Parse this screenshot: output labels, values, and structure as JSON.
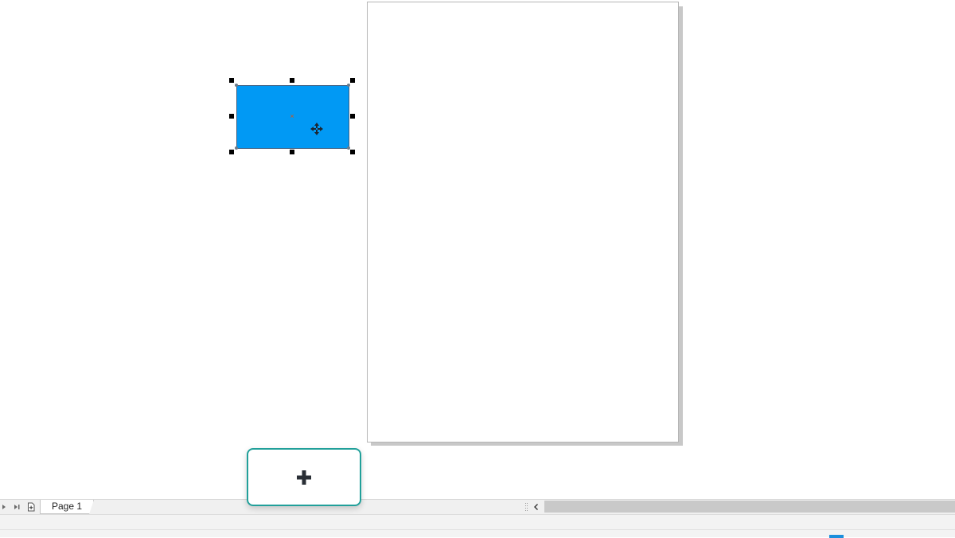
{
  "document": {
    "pages": [
      {
        "label": "Page 1"
      }
    ]
  },
  "colors": {
    "shape_fill": "#0199f4",
    "accent_button_border": "#21a09a",
    "page_background": "#ffffff",
    "status_swatch": "#1c8fdc"
  },
  "icons": {
    "add_button": "plus-icon",
    "selection_cursor": "move-cursor-icon",
    "tab_nav": [
      "next-page-icon",
      "last-page-icon",
      "add-page-icon"
    ],
    "scroll": "chevron-left-icon"
  }
}
